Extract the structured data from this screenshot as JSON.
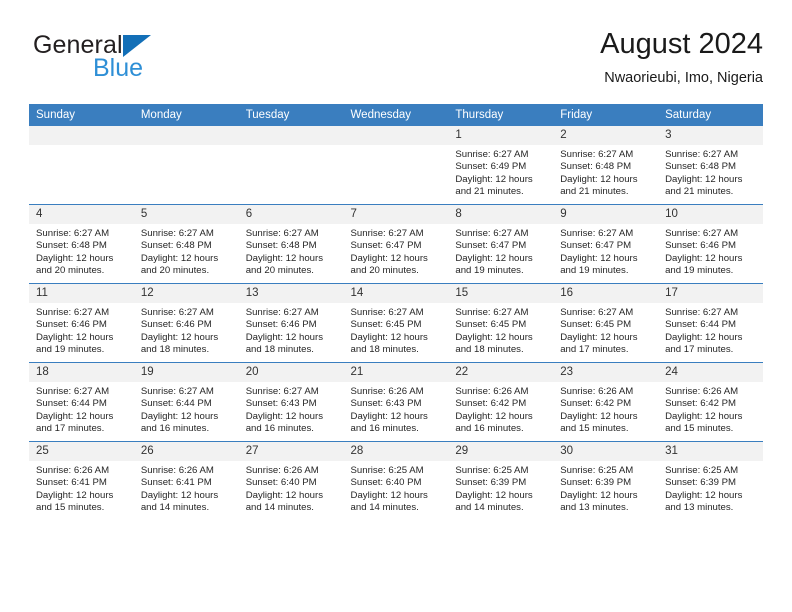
{
  "brand": {
    "name_line1": "General",
    "name_line2": "Blue",
    "triangle_color": "#136fb7",
    "blue_color": "#2e8fd6"
  },
  "header": {
    "title": "August 2024",
    "subtitle": "Nwaorieubi, Imo, Nigeria"
  },
  "theme": {
    "header_bar_color": "#3a7ebf",
    "daynum_bg": "#f2f2f2",
    "grid_line": "#3a7ebf"
  },
  "weekday_headers": [
    "Sunday",
    "Monday",
    "Tuesday",
    "Wednesday",
    "Thursday",
    "Friday",
    "Saturday"
  ],
  "labels": {
    "sunrise_prefix": "Sunrise:",
    "sunset_prefix": "Sunset:",
    "daylight_prefix": "Daylight:"
  },
  "weeks": [
    [
      {
        "day": "",
        "blank": true
      },
      {
        "day": "",
        "blank": true
      },
      {
        "day": "",
        "blank": true
      },
      {
        "day": "",
        "blank": true
      },
      {
        "day": "1",
        "sunrise": "Sunrise: 6:27 AM",
        "sunset": "Sunset: 6:49 PM",
        "daylight_l1": "Daylight: 12 hours",
        "daylight_l2": "and 21 minutes."
      },
      {
        "day": "2",
        "sunrise": "Sunrise: 6:27 AM",
        "sunset": "Sunset: 6:48 PM",
        "daylight_l1": "Daylight: 12 hours",
        "daylight_l2": "and 21 minutes."
      },
      {
        "day": "3",
        "sunrise": "Sunrise: 6:27 AM",
        "sunset": "Sunset: 6:48 PM",
        "daylight_l1": "Daylight: 12 hours",
        "daylight_l2": "and 21 minutes."
      }
    ],
    [
      {
        "day": "4",
        "sunrise": "Sunrise: 6:27 AM",
        "sunset": "Sunset: 6:48 PM",
        "daylight_l1": "Daylight: 12 hours",
        "daylight_l2": "and 20 minutes."
      },
      {
        "day": "5",
        "sunrise": "Sunrise: 6:27 AM",
        "sunset": "Sunset: 6:48 PM",
        "daylight_l1": "Daylight: 12 hours",
        "daylight_l2": "and 20 minutes."
      },
      {
        "day": "6",
        "sunrise": "Sunrise: 6:27 AM",
        "sunset": "Sunset: 6:48 PM",
        "daylight_l1": "Daylight: 12 hours",
        "daylight_l2": "and 20 minutes."
      },
      {
        "day": "7",
        "sunrise": "Sunrise: 6:27 AM",
        "sunset": "Sunset: 6:47 PM",
        "daylight_l1": "Daylight: 12 hours",
        "daylight_l2": "and 20 minutes."
      },
      {
        "day": "8",
        "sunrise": "Sunrise: 6:27 AM",
        "sunset": "Sunset: 6:47 PM",
        "daylight_l1": "Daylight: 12 hours",
        "daylight_l2": "and 19 minutes."
      },
      {
        "day": "9",
        "sunrise": "Sunrise: 6:27 AM",
        "sunset": "Sunset: 6:47 PM",
        "daylight_l1": "Daylight: 12 hours",
        "daylight_l2": "and 19 minutes."
      },
      {
        "day": "10",
        "sunrise": "Sunrise: 6:27 AM",
        "sunset": "Sunset: 6:46 PM",
        "daylight_l1": "Daylight: 12 hours",
        "daylight_l2": "and 19 minutes."
      }
    ],
    [
      {
        "day": "11",
        "sunrise": "Sunrise: 6:27 AM",
        "sunset": "Sunset: 6:46 PM",
        "daylight_l1": "Daylight: 12 hours",
        "daylight_l2": "and 19 minutes."
      },
      {
        "day": "12",
        "sunrise": "Sunrise: 6:27 AM",
        "sunset": "Sunset: 6:46 PM",
        "daylight_l1": "Daylight: 12 hours",
        "daylight_l2": "and 18 minutes."
      },
      {
        "day": "13",
        "sunrise": "Sunrise: 6:27 AM",
        "sunset": "Sunset: 6:46 PM",
        "daylight_l1": "Daylight: 12 hours",
        "daylight_l2": "and 18 minutes."
      },
      {
        "day": "14",
        "sunrise": "Sunrise: 6:27 AM",
        "sunset": "Sunset: 6:45 PM",
        "daylight_l1": "Daylight: 12 hours",
        "daylight_l2": "and 18 minutes."
      },
      {
        "day": "15",
        "sunrise": "Sunrise: 6:27 AM",
        "sunset": "Sunset: 6:45 PM",
        "daylight_l1": "Daylight: 12 hours",
        "daylight_l2": "and 18 minutes."
      },
      {
        "day": "16",
        "sunrise": "Sunrise: 6:27 AM",
        "sunset": "Sunset: 6:45 PM",
        "daylight_l1": "Daylight: 12 hours",
        "daylight_l2": "and 17 minutes."
      },
      {
        "day": "17",
        "sunrise": "Sunrise: 6:27 AM",
        "sunset": "Sunset: 6:44 PM",
        "daylight_l1": "Daylight: 12 hours",
        "daylight_l2": "and 17 minutes."
      }
    ],
    [
      {
        "day": "18",
        "sunrise": "Sunrise: 6:27 AM",
        "sunset": "Sunset: 6:44 PM",
        "daylight_l1": "Daylight: 12 hours",
        "daylight_l2": "and 17 minutes."
      },
      {
        "day": "19",
        "sunrise": "Sunrise: 6:27 AM",
        "sunset": "Sunset: 6:44 PM",
        "daylight_l1": "Daylight: 12 hours",
        "daylight_l2": "and 16 minutes."
      },
      {
        "day": "20",
        "sunrise": "Sunrise: 6:27 AM",
        "sunset": "Sunset: 6:43 PM",
        "daylight_l1": "Daylight: 12 hours",
        "daylight_l2": "and 16 minutes."
      },
      {
        "day": "21",
        "sunrise": "Sunrise: 6:26 AM",
        "sunset": "Sunset: 6:43 PM",
        "daylight_l1": "Daylight: 12 hours",
        "daylight_l2": "and 16 minutes."
      },
      {
        "day": "22",
        "sunrise": "Sunrise: 6:26 AM",
        "sunset": "Sunset: 6:42 PM",
        "daylight_l1": "Daylight: 12 hours",
        "daylight_l2": "and 16 minutes."
      },
      {
        "day": "23",
        "sunrise": "Sunrise: 6:26 AM",
        "sunset": "Sunset: 6:42 PM",
        "daylight_l1": "Daylight: 12 hours",
        "daylight_l2": "and 15 minutes."
      },
      {
        "day": "24",
        "sunrise": "Sunrise: 6:26 AM",
        "sunset": "Sunset: 6:42 PM",
        "daylight_l1": "Daylight: 12 hours",
        "daylight_l2": "and 15 minutes."
      }
    ],
    [
      {
        "day": "25",
        "sunrise": "Sunrise: 6:26 AM",
        "sunset": "Sunset: 6:41 PM",
        "daylight_l1": "Daylight: 12 hours",
        "daylight_l2": "and 15 minutes."
      },
      {
        "day": "26",
        "sunrise": "Sunrise: 6:26 AM",
        "sunset": "Sunset: 6:41 PM",
        "daylight_l1": "Daylight: 12 hours",
        "daylight_l2": "and 14 minutes."
      },
      {
        "day": "27",
        "sunrise": "Sunrise: 6:26 AM",
        "sunset": "Sunset: 6:40 PM",
        "daylight_l1": "Daylight: 12 hours",
        "daylight_l2": "and 14 minutes."
      },
      {
        "day": "28",
        "sunrise": "Sunrise: 6:25 AM",
        "sunset": "Sunset: 6:40 PM",
        "daylight_l1": "Daylight: 12 hours",
        "daylight_l2": "and 14 minutes."
      },
      {
        "day": "29",
        "sunrise": "Sunrise: 6:25 AM",
        "sunset": "Sunset: 6:39 PM",
        "daylight_l1": "Daylight: 12 hours",
        "daylight_l2": "and 14 minutes."
      },
      {
        "day": "30",
        "sunrise": "Sunrise: 6:25 AM",
        "sunset": "Sunset: 6:39 PM",
        "daylight_l1": "Daylight: 12 hours",
        "daylight_l2": "and 13 minutes."
      },
      {
        "day": "31",
        "sunrise": "Sunrise: 6:25 AM",
        "sunset": "Sunset: 6:39 PM",
        "daylight_l1": "Daylight: 12 hours",
        "daylight_l2": "and 13 minutes."
      }
    ]
  ]
}
